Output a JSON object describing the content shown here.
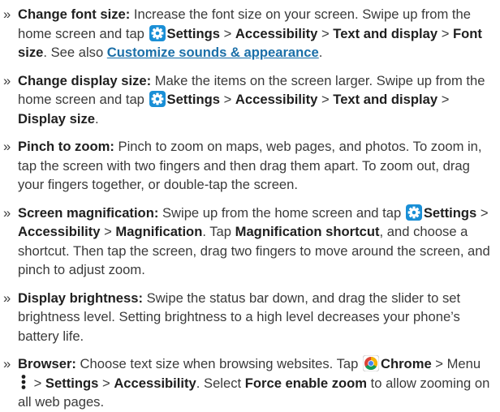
{
  "items": [
    {
      "title": "Change font size:",
      "t1": " Increase the font size on your screen. Swipe up from the home screen and tap ",
      "s1": "Settings",
      "sep1": " > ",
      "s2": "Accessibility",
      "sep2": " > ",
      "s3": "Text and display",
      "sep3": " > ",
      "s4": "Font size",
      "t2": ". See also ",
      "link": "Customize sounds & appearance",
      "t3": "."
    },
    {
      "title": "Change display size:",
      "t1": " Make the items on the screen larger. Swipe up from the home screen and tap ",
      "s1": "Settings",
      "sep1": " > ",
      "s2": "Accessibility",
      "sep2": " > ",
      "s3": "Text and display",
      "sep3": " > ",
      "s4": "Display size",
      "t2": "."
    },
    {
      "title": "Pinch to zoom:",
      "t1": " Pinch to zoom on maps, web pages, and photos. To zoom in, tap the screen with two fingers and then drag them apart. To zoom out, drag your fingers together, or double-tap the screen."
    },
    {
      "title": "Screen magnification:",
      "t1": " Swipe up from the home screen and tap ",
      "s1": "Settings",
      "sep1": " > ",
      "s2": "Accessibility",
      "sep2": " > ",
      "s3": "Magnification",
      "t2": ". Tap ",
      "s4": "Magnification shortcut",
      "t3": ", and choose a shortcut. Then tap the screen, drag two fingers to move around the screen, and pinch to adjust zoom."
    },
    {
      "title": "Display brightness:",
      "t1": " Swipe the status bar down, and drag the slider to set brightness level. Setting brightness to a high level decreases your phone’s battery life."
    },
    {
      "title": "Browser:",
      "t1": " Choose text size when browsing websites. Tap ",
      "s1": "Chrome",
      "sep1": " > Menu ",
      "sep2": " > ",
      "s2": "Settings",
      "sep3": " > ",
      "s3": "Accessibility",
      "t2": ". Select ",
      "s4": "Force enable zoom",
      "t3": " to allow zooming on all web pages."
    }
  ],
  "bullet": "»",
  "colors": {
    "text": "#3a3a3a",
    "bold": "#1f1f1f",
    "link": "#1b6fa8",
    "settings_icon": "#1a8fd6"
  },
  "icons": {
    "settings": "settings-gear-icon",
    "chrome": "chrome-icon",
    "menu": "more-vertical-icon"
  }
}
